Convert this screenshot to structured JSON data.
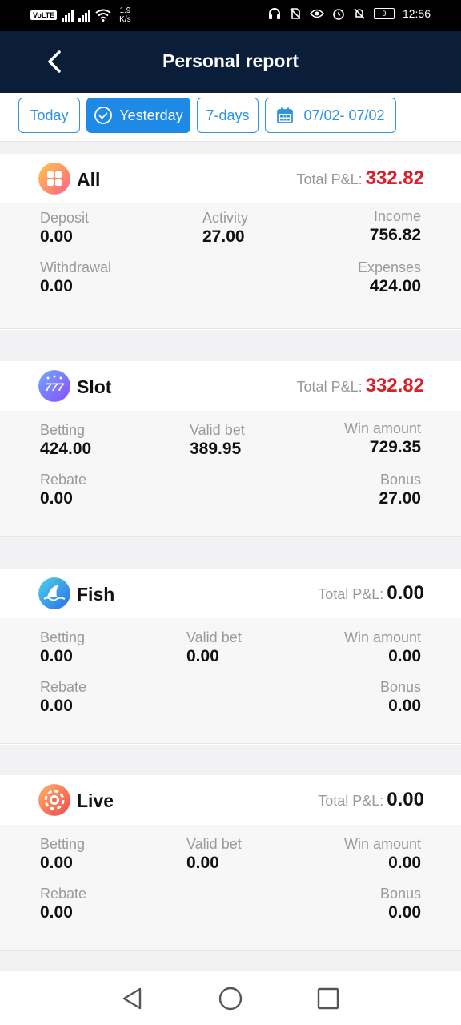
{
  "status_bar": {
    "volte": "VoLTE",
    "net_speed": "1.9",
    "net_speed_unit": "K/s",
    "battery": "9",
    "time": "12:56"
  },
  "header": {
    "title": "Personal report",
    "back_icon": "chevron-left-icon"
  },
  "filters": {
    "today": "Today",
    "yesterday": "Yesterday",
    "seven_days": "7-days",
    "date_range": "07/02- 07/02",
    "selected": "Yesterday"
  },
  "total_pl_label": "Total P&L:",
  "cards": {
    "all": {
      "name": "All",
      "total_pl": "332.82",
      "deposit_label": "Deposit",
      "deposit": "0.00",
      "activity_label": "Activity",
      "activity": "27.00",
      "income_label": "Income",
      "income": "756.82",
      "withdrawal_label": "Withdrawal",
      "withdrawal": "0.00",
      "expenses_label": "Expenses",
      "expenses": "424.00"
    },
    "slot": {
      "name": "Slot",
      "total_pl": "332.82",
      "betting_label": "Betting",
      "betting": "424.00",
      "valid_bet_label": "Valid bet",
      "valid_bet": "389.95",
      "win_label": "Win amount",
      "win": "729.35",
      "rebate_label": "Rebate",
      "rebate": "0.00",
      "bonus_label": "Bonus",
      "bonus": "27.00"
    },
    "fish": {
      "name": "Fish",
      "total_pl": "0.00",
      "betting_label": "Betting",
      "betting": "0.00",
      "valid_bet_label": "Valid bet",
      "valid_bet": "0.00",
      "win_label": "Win amount",
      "win": "0.00",
      "rebate_label": "Rebate",
      "rebate": "0.00",
      "bonus_label": "Bonus",
      "bonus": "0.00"
    },
    "live": {
      "name": "Live",
      "total_pl": "0.00",
      "betting_label": "Betting",
      "betting": "0.00",
      "valid_bet_label": "Valid bet",
      "valid_bet": "0.00",
      "win_label": "Win amount",
      "win": "0.00",
      "rebate_label": "Rebate",
      "rebate": "0.00",
      "bonus_label": "Bonus",
      "bonus": "0.00"
    }
  },
  "colors": {
    "header": "#0a1e3a",
    "accent": "#1e8ae6",
    "profit": "#d8202a"
  },
  "icons": {
    "all": "grid-icon",
    "slot": "slot-777-icon",
    "fish": "shark-fin-icon",
    "live": "poker-chip-icon",
    "calendar": "calendar-icon",
    "check": "check-circle-icon",
    "nav_back": "triangle-back-icon",
    "nav_home": "circle-home-icon",
    "nav_recent": "square-recent-icon"
  }
}
